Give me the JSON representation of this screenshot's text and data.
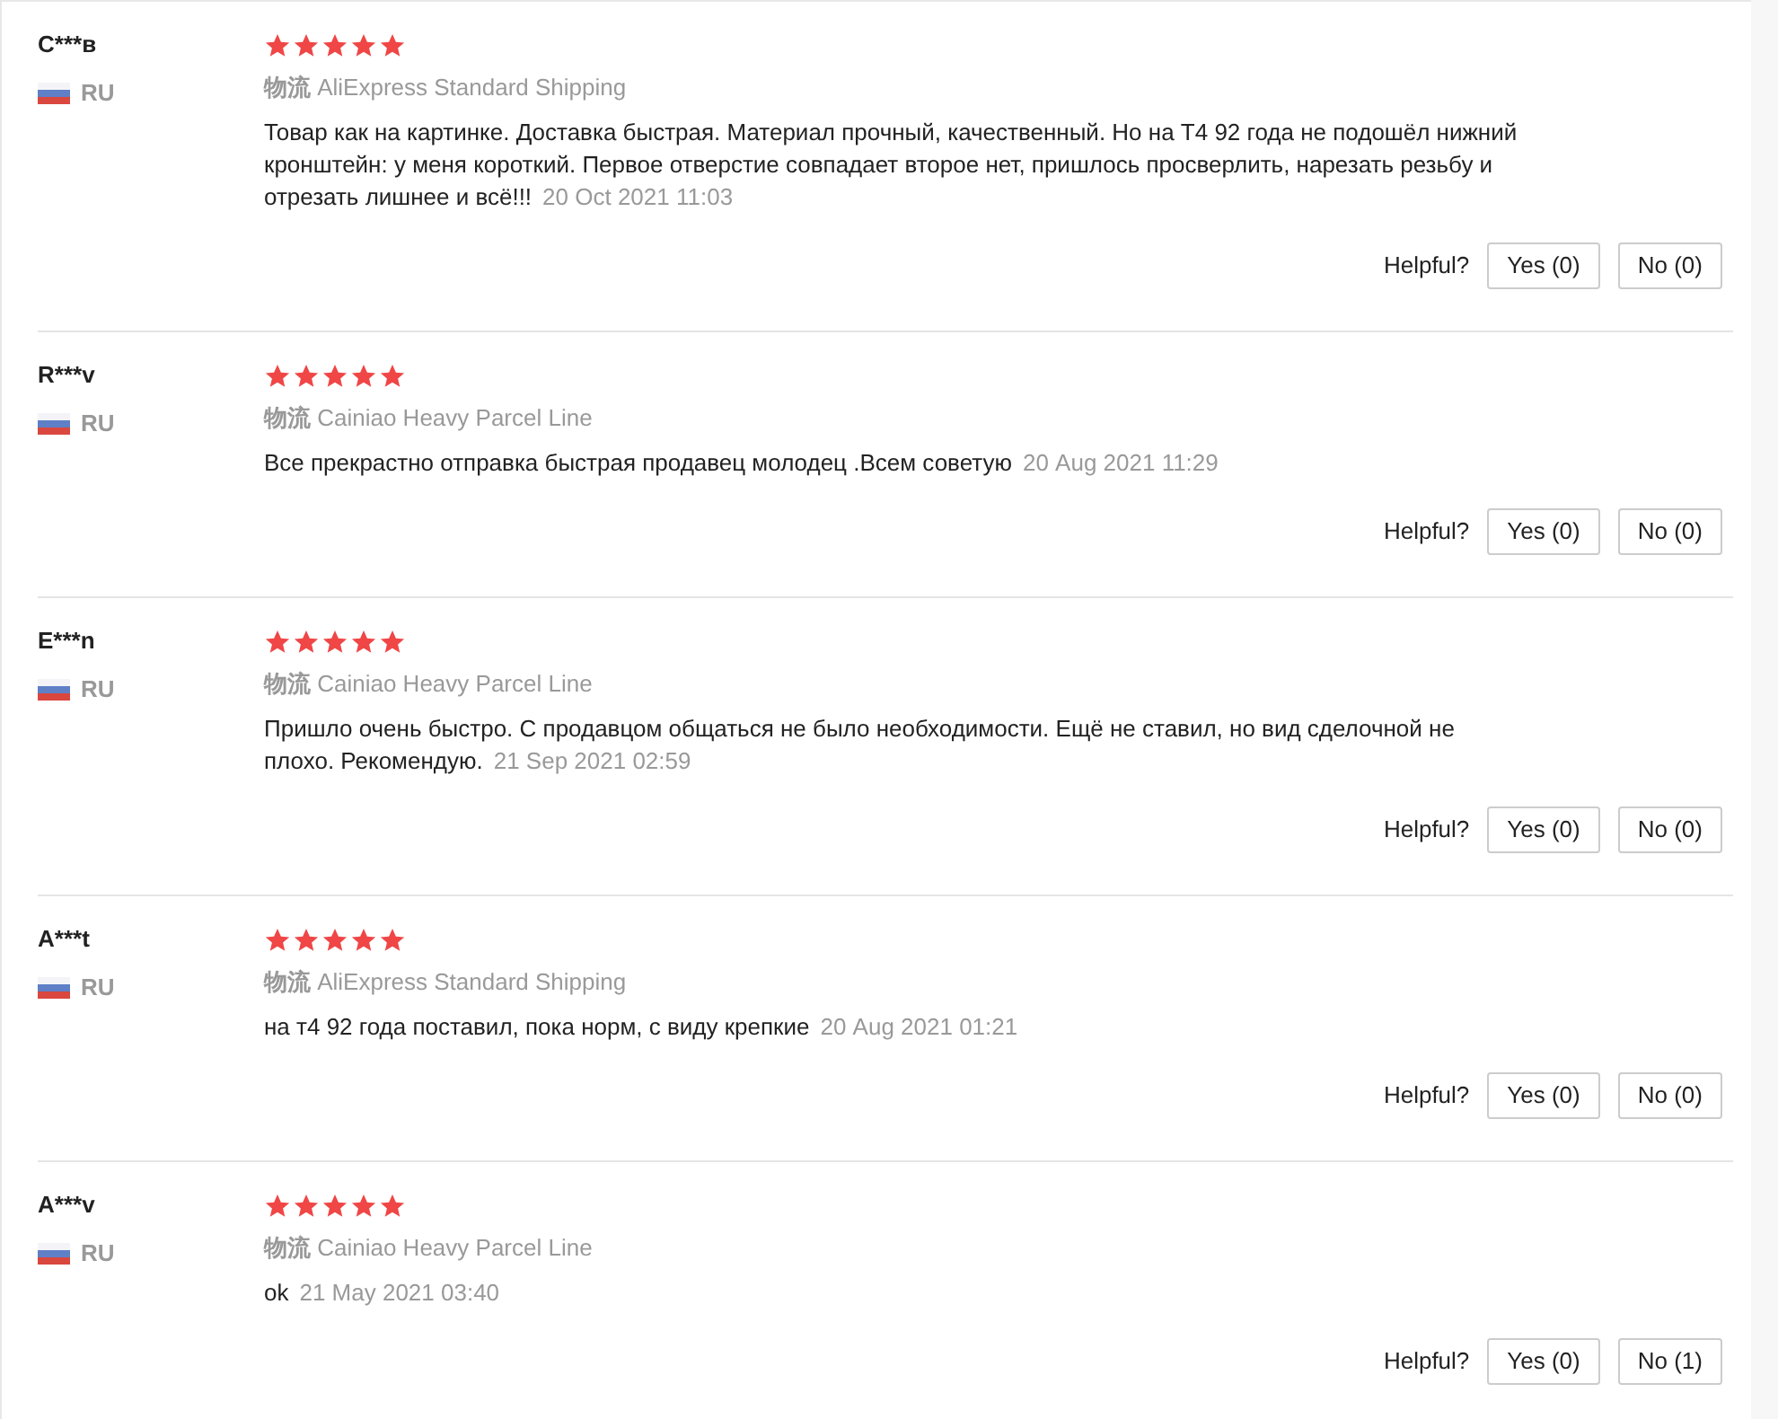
{
  "reviews": [
    {
      "name": "C***в",
      "country": "RU",
      "stars": 5,
      "shipping_label": "物流",
      "shipping": "AliExpress Standard Shipping",
      "text": "Товар как на картинке. Доставка быстрая. Материал прочный, качественный. Но на Т4 92 года не подошёл нижний кронштейн: у меня короткий. Первое отверстие совпадает второе нет, пришлось просверлить, нарезать резьбу и отрезать лишнее и всё!!!",
      "date": "20 Oct 2021 11:03",
      "helpful_label": "Helpful?",
      "yes": "Yes (0)",
      "no": "No (0)"
    },
    {
      "name": "R***v",
      "country": "RU",
      "stars": 5,
      "shipping_label": "物流",
      "shipping": "Cainiao Heavy Parcel Line",
      "text": "Все прекрастно отправка быстрая продавец молодец .Всем советую",
      "date": "20 Aug 2021 11:29",
      "helpful_label": "Helpful?",
      "yes": "Yes (0)",
      "no": "No (0)"
    },
    {
      "name": "E***n",
      "country": "RU",
      "stars": 5,
      "shipping_label": "物流",
      "shipping": "Cainiao Heavy Parcel Line",
      "text": "Пришло очень быстро. С продавцом общаться не было необходимости. Ещё не ставил, но вид сделочной не плохо. Рекомендую.",
      "date": "21 Sep 2021 02:59",
      "helpful_label": "Helpful?",
      "yes": "Yes (0)",
      "no": "No (0)"
    },
    {
      "name": "A***t",
      "country": "RU",
      "stars": 5,
      "shipping_label": "物流",
      "shipping": "AliExpress Standard Shipping",
      "text": "на т4 92 года поставил, пока норм, с виду крепкие",
      "date": "20 Aug 2021 01:21",
      "helpful_label": "Helpful?",
      "yes": "Yes (0)",
      "no": "No (0)"
    },
    {
      "name": "A***v",
      "country": "RU",
      "stars": 5,
      "shipping_label": "物流",
      "shipping": "Cainiao Heavy Parcel Line",
      "text": "ok",
      "date": "21 May 2021 03:40",
      "helpful_label": "Helpful?",
      "yes": "Yes (0)",
      "no": "No (1)"
    }
  ]
}
